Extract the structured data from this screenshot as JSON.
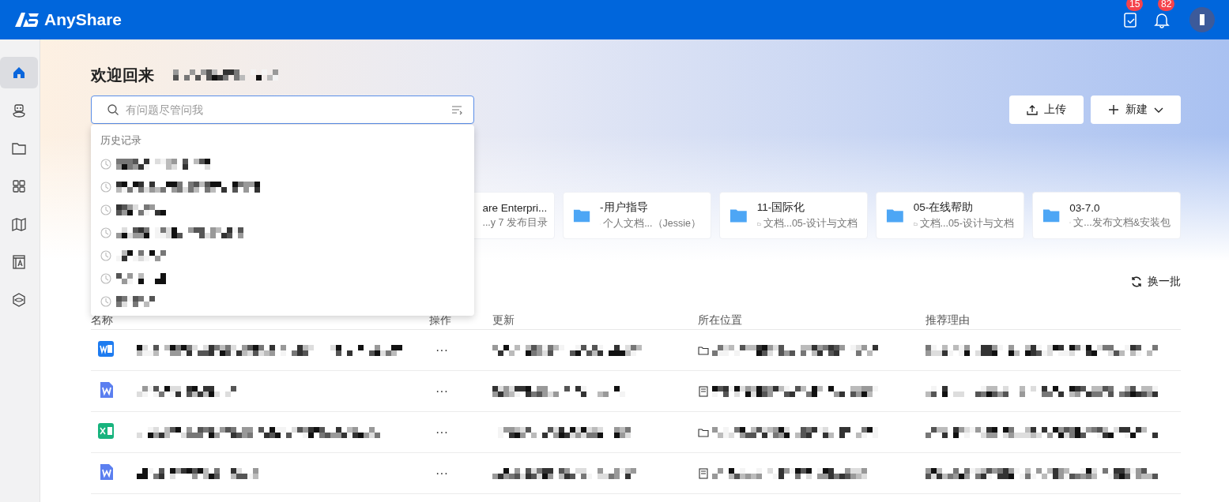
{
  "header": {
    "logo": "AnyShare",
    "badges": [
      {
        "kind": "tasks",
        "count": "15"
      },
      {
        "kind": "notifications",
        "count": "82"
      }
    ]
  },
  "sidebar": {
    "items": [
      {
        "kind": "home",
        "selected": true
      },
      {
        "kind": "robot",
        "selected": false
      },
      {
        "kind": "folder",
        "selected": false
      },
      {
        "kind": "apps",
        "selected": false
      },
      {
        "kind": "map",
        "selected": false
      },
      {
        "kind": "template",
        "selected": false
      },
      {
        "kind": "cube",
        "selected": false
      }
    ]
  },
  "welcome": {
    "title": "欢迎回来",
    "user_name": {
      "kind": "redacted"
    }
  },
  "search": {
    "placeholder": "有问题尽管问我",
    "history": {
      "title": "历史记录",
      "items": [
        {
          "kind": "redacted"
        },
        {
          "kind": "redacted"
        },
        {
          "kind": "redacted"
        },
        {
          "kind": "redacted"
        },
        {
          "kind": "redacted"
        },
        {
          "kind": "redacted"
        },
        {
          "kind": "redacted"
        }
      ]
    }
  },
  "actions": [
    {
      "kind": "upload",
      "label": "上传"
    },
    {
      "kind": "new",
      "label": "新建"
    }
  ],
  "recent": [
    {
      "kind": "partial",
      "title": "are Enterpri...",
      "path": "...y 7 发布目录"
    },
    {
      "kind": "folder",
      "title": "-用户指导",
      "path": "个人文档...（Jessie）"
    },
    {
      "kind": "folder",
      "title": "11-国际化",
      "path": "文档...05-设计与文档"
    },
    {
      "kind": "folder",
      "title": "05-在线帮助",
      "path": "文档...05-设计与文档"
    },
    {
      "kind": "folder",
      "title": "03-7.0",
      "path": "文...发布文档&安装包"
    }
  ],
  "refresh": {
    "label": "换一批"
  },
  "table": {
    "columns": [
      "名称",
      "操作",
      "更新",
      "所在位置",
      "推荐理由"
    ],
    "rows": [
      {
        "kind": "word",
        "action": "···",
        "location": {
          "kind": "folder"
        }
      },
      {
        "kind": "wps",
        "action": "···",
        "location": {
          "kind": "library"
        }
      },
      {
        "kind": "excel",
        "action": "···",
        "location": {
          "kind": "folder"
        }
      },
      {
        "kind": "wps",
        "action": "···",
        "location": {
          "kind": "library"
        }
      }
    ]
  }
}
